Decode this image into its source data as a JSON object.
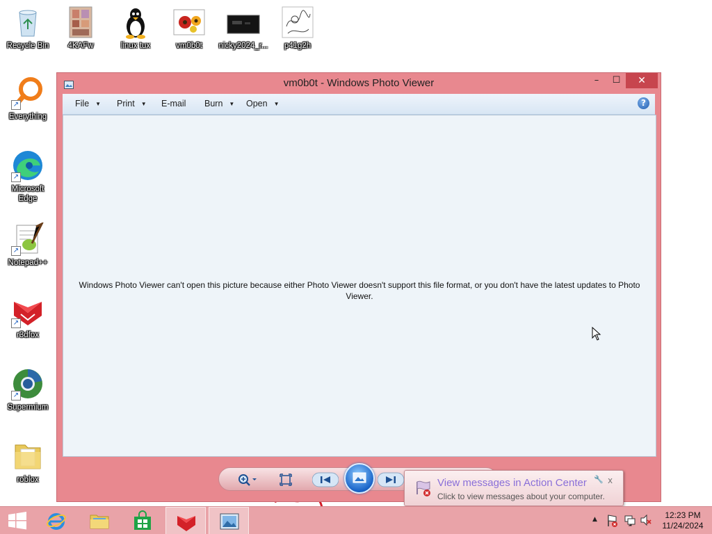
{
  "desktop": {
    "icons": [
      {
        "label": "Recycle Bin"
      },
      {
        "label": "4KAFw"
      },
      {
        "label": "linux tux"
      },
      {
        "label": "vm0b0t"
      },
      {
        "label": "nicky2024_r..."
      },
      {
        "label": "p41g2h"
      },
      {
        "label": "Everything"
      },
      {
        "label": "Microsoft Edge"
      },
      {
        "label": "Notepad++"
      },
      {
        "label": "r3dfox"
      },
      {
        "label": "Supermium"
      },
      {
        "label": "roblox"
      }
    ]
  },
  "window": {
    "title": "vm0b0t - Windows Photo Viewer",
    "controls": {
      "minimize": "–",
      "maximize": "☐",
      "close": "✕"
    },
    "menu": [
      {
        "label": "File",
        "has_dropdown": true
      },
      {
        "label": "Print",
        "has_dropdown": true
      },
      {
        "label": "E-mail",
        "has_dropdown": false
      },
      {
        "label": "Burn",
        "has_dropdown": true
      },
      {
        "label": "Open",
        "has_dropdown": true
      }
    ],
    "help_label": "?",
    "error_message": "Windows Photo Viewer can't open this picture because either Photo Viewer doesn't support this file format, or you don't have the latest updates to Photo Viewer."
  },
  "notification": {
    "title": "View messages in Action Center",
    "text": "Click to view messages about your computer.",
    "close": "x"
  },
  "taskbar": {
    "clock_time": "12:23 PM",
    "clock_date": "11/24/2024",
    "tray_expand": "▲"
  },
  "colors": {
    "window_frame": "#e8888f",
    "close_button": "#c7454e",
    "taskbar": "#e9a3a8",
    "content_bg": "#eef4f9"
  }
}
